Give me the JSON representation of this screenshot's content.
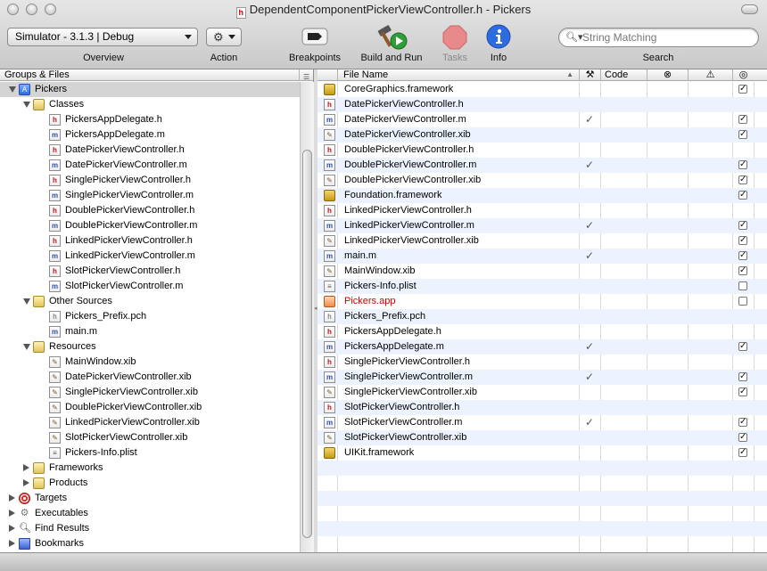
{
  "window": {
    "title": "DependentComponentPickerViewController.h - Pickers"
  },
  "toolbar": {
    "overview_value": "Simulator - 3.1.3 | Debug",
    "overview_label": "Overview",
    "action_label": "Action",
    "breakpoints_label": "Breakpoints",
    "build_run_label": "Build and Run",
    "tasks_label": "Tasks",
    "info_label": "Info",
    "search_placeholder": "String Matching",
    "search_label": "Search"
  },
  "sidebar": {
    "header": "Groups & Files",
    "tree": [
      {
        "label": "Pickers",
        "icon": "project-icon",
        "level": 0,
        "disclosure": "open",
        "selected": true
      },
      {
        "label": "Classes",
        "icon": "folder-icon",
        "level": 1,
        "disclosure": "open"
      },
      {
        "label": "PickersAppDelegate.h",
        "icon": "h",
        "level": 2
      },
      {
        "label": "PickersAppDelegate.m",
        "icon": "m",
        "level": 2
      },
      {
        "label": "DatePickerViewController.h",
        "icon": "h",
        "level": 2
      },
      {
        "label": "DatePickerViewController.m",
        "icon": "m",
        "level": 2
      },
      {
        "label": "SinglePickerViewController.h",
        "icon": "h",
        "level": 2
      },
      {
        "label": "SinglePickerViewController.m",
        "icon": "m",
        "level": 2
      },
      {
        "label": "DoublePickerViewController.h",
        "icon": "h",
        "level": 2
      },
      {
        "label": "DoublePickerViewController.m",
        "icon": "m",
        "level": 2
      },
      {
        "label": "LinkedPickerViewController.h",
        "icon": "h",
        "level": 2
      },
      {
        "label": "LinkedPickerViewController.m",
        "icon": "m",
        "level": 2
      },
      {
        "label": "SlotPickerViewController.h",
        "icon": "h",
        "level": 2
      },
      {
        "label": "SlotPickerViewController.m",
        "icon": "m",
        "level": 2
      },
      {
        "label": "Other Sources",
        "icon": "folder-icon",
        "level": 1,
        "disclosure": "open"
      },
      {
        "label": "Pickers_Prefix.pch",
        "icon": "pch",
        "level": 2
      },
      {
        "label": "main.m",
        "icon": "m",
        "level": 2
      },
      {
        "label": "Resources",
        "icon": "folder-icon",
        "level": 1,
        "disclosure": "open"
      },
      {
        "label": "MainWindow.xib",
        "icon": "xib",
        "level": 2
      },
      {
        "label": "DatePickerViewController.xib",
        "icon": "xib",
        "level": 2
      },
      {
        "label": "SinglePickerViewController.xib",
        "icon": "xib",
        "level": 2
      },
      {
        "label": "DoublePickerViewController.xib",
        "icon": "xib",
        "level": 2
      },
      {
        "label": "LinkedPickerViewController.xib",
        "icon": "xib",
        "level": 2
      },
      {
        "label": "SlotPickerViewController.xib",
        "icon": "xib",
        "level": 2
      },
      {
        "label": "Pickers-Info.plist",
        "icon": "plist",
        "level": 2
      },
      {
        "label": "Frameworks",
        "icon": "folder-icon",
        "level": 1,
        "disclosure": "closed"
      },
      {
        "label": "Products",
        "icon": "folder-icon",
        "level": 1,
        "disclosure": "closed"
      },
      {
        "label": "Targets",
        "icon": "target-icon",
        "level": 0,
        "disclosure": "closed"
      },
      {
        "label": "Executables",
        "icon": "executable-icon",
        "level": 0,
        "disclosure": "closed"
      },
      {
        "label": "Find Results",
        "icon": "magnifier-icon",
        "level": 0,
        "disclosure": "closed"
      },
      {
        "label": "Bookmarks",
        "icon": "bookmark-icon",
        "level": 0,
        "disclosure": "closed"
      }
    ]
  },
  "detail": {
    "columns": {
      "file_name": "File Name",
      "code": "Code"
    },
    "files": [
      {
        "name": "CoreGraphics.framework",
        "icon": "framework",
        "built": false,
        "target": true
      },
      {
        "name": "DatePickerViewController.h",
        "icon": "h",
        "built": false,
        "target": null
      },
      {
        "name": "DatePickerViewController.m",
        "icon": "m",
        "built": true,
        "target": true
      },
      {
        "name": "DatePickerViewController.xib",
        "icon": "xib",
        "built": false,
        "target": true
      },
      {
        "name": "DoublePickerViewController.h",
        "icon": "h",
        "built": false,
        "target": null
      },
      {
        "name": "DoublePickerViewController.m",
        "icon": "m",
        "built": true,
        "target": true
      },
      {
        "name": "DoublePickerViewController.xib",
        "icon": "xib",
        "built": false,
        "target": true
      },
      {
        "name": "Foundation.framework",
        "icon": "framework",
        "built": false,
        "target": true
      },
      {
        "name": "LinkedPickerViewController.h",
        "icon": "h",
        "built": false,
        "target": null
      },
      {
        "name": "LinkedPickerViewController.m",
        "icon": "m",
        "built": true,
        "target": true
      },
      {
        "name": "LinkedPickerViewController.xib",
        "icon": "xib",
        "built": false,
        "target": true
      },
      {
        "name": "main.m",
        "icon": "m",
        "built": true,
        "target": true
      },
      {
        "name": "MainWindow.xib",
        "icon": "xib",
        "built": false,
        "target": true
      },
      {
        "name": "Pickers-Info.plist",
        "icon": "plist",
        "built": false,
        "target": false
      },
      {
        "name": "Pickers.app",
        "icon": "app",
        "built": false,
        "target": false,
        "missing": true
      },
      {
        "name": "Pickers_Prefix.pch",
        "icon": "pch",
        "built": false,
        "target": null
      },
      {
        "name": "PickersAppDelegate.h",
        "icon": "h",
        "built": false,
        "target": null
      },
      {
        "name": "PickersAppDelegate.m",
        "icon": "m",
        "built": true,
        "target": true
      },
      {
        "name": "SinglePickerViewController.h",
        "icon": "h",
        "built": false,
        "target": null
      },
      {
        "name": "SinglePickerViewController.m",
        "icon": "m",
        "built": true,
        "target": true
      },
      {
        "name": "SinglePickerViewController.xib",
        "icon": "xib",
        "built": false,
        "target": true
      },
      {
        "name": "SlotPickerViewController.h",
        "icon": "h",
        "built": false,
        "target": null
      },
      {
        "name": "SlotPickerViewController.m",
        "icon": "m",
        "built": true,
        "target": true
      },
      {
        "name": "SlotPickerViewController.xib",
        "icon": "xib",
        "built": false,
        "target": true
      },
      {
        "name": "UIKit.framework",
        "icon": "framework",
        "built": false,
        "target": true
      }
    ],
    "empty_rows": 6
  },
  "colors": {
    "selection_gray": "#d4d4d4",
    "stripe_blue": "#edf3fe",
    "missing_red": "#d00000",
    "info_blue": "#2d6be0",
    "tasks_red": "#e06060"
  }
}
